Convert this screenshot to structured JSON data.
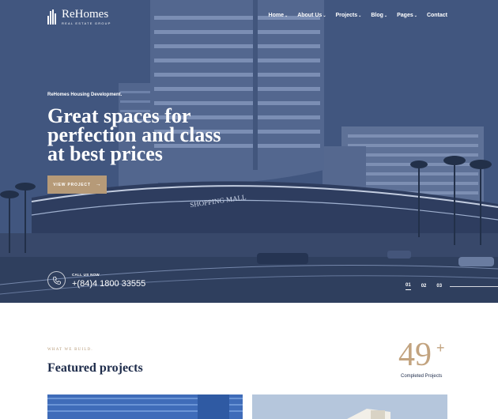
{
  "header": {
    "brand_name": "ReHomes",
    "brand_tagline": "REAL ESTATE GROUP",
    "nav": [
      {
        "label": "Home",
        "has_dropdown": true
      },
      {
        "label": "About Us",
        "has_dropdown": true
      },
      {
        "label": "Projects",
        "has_dropdown": true
      },
      {
        "label": "Blog",
        "has_dropdown": true
      },
      {
        "label": "Pages",
        "has_dropdown": true
      },
      {
        "label": "Contact",
        "has_dropdown": false
      }
    ]
  },
  "hero": {
    "kicker": "ReHomes Housing Development.",
    "headline": [
      "Great spaces for",
      "perfection and class",
      "at best prices"
    ],
    "cta_label": "VIEW PROJECT",
    "cta_icon": "arrow-right-icon",
    "call_label": "CALL US NOW",
    "call_number": "+(84)4 1800 33555",
    "call_icon": "phone-icon",
    "slides": [
      "01",
      "02",
      "03"
    ],
    "active_slide": "01",
    "building_sign": "SHOPPING MALL"
  },
  "featured": {
    "eyebrow": "WHAT WE BUILD.",
    "title": "Featured projects",
    "stat_value": "49",
    "stat_suffix": "+",
    "stat_label": "Completed Projects"
  },
  "colors": {
    "accent": "#b69a78",
    "heading_navy": "#1d2b4a",
    "hero_overlay": "#3f5480"
  }
}
